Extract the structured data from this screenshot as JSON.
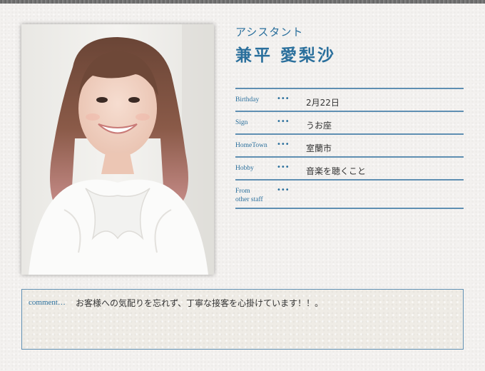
{
  "profile": {
    "role": "アシスタント",
    "name": "兼平 愛梨沙",
    "rows": [
      {
        "label": "Birthday",
        "value": "2月22日"
      },
      {
        "label": "Sign",
        "value": "うお座"
      },
      {
        "label": "HomeTown",
        "value": "室蘭市"
      },
      {
        "label": "Hobby",
        "value": "音楽を聴くこと"
      },
      {
        "label": "From\nother staff",
        "value": ""
      }
    ],
    "dots": "•••"
  },
  "comment": {
    "label": "comment…",
    "text": "お客様への気配りを忘れず、丁寧な接客を心掛けています！！。"
  },
  "colors": {
    "accent": "#2a6f9c",
    "rule": "#5f8fb2",
    "background": "#f3f1ef"
  }
}
